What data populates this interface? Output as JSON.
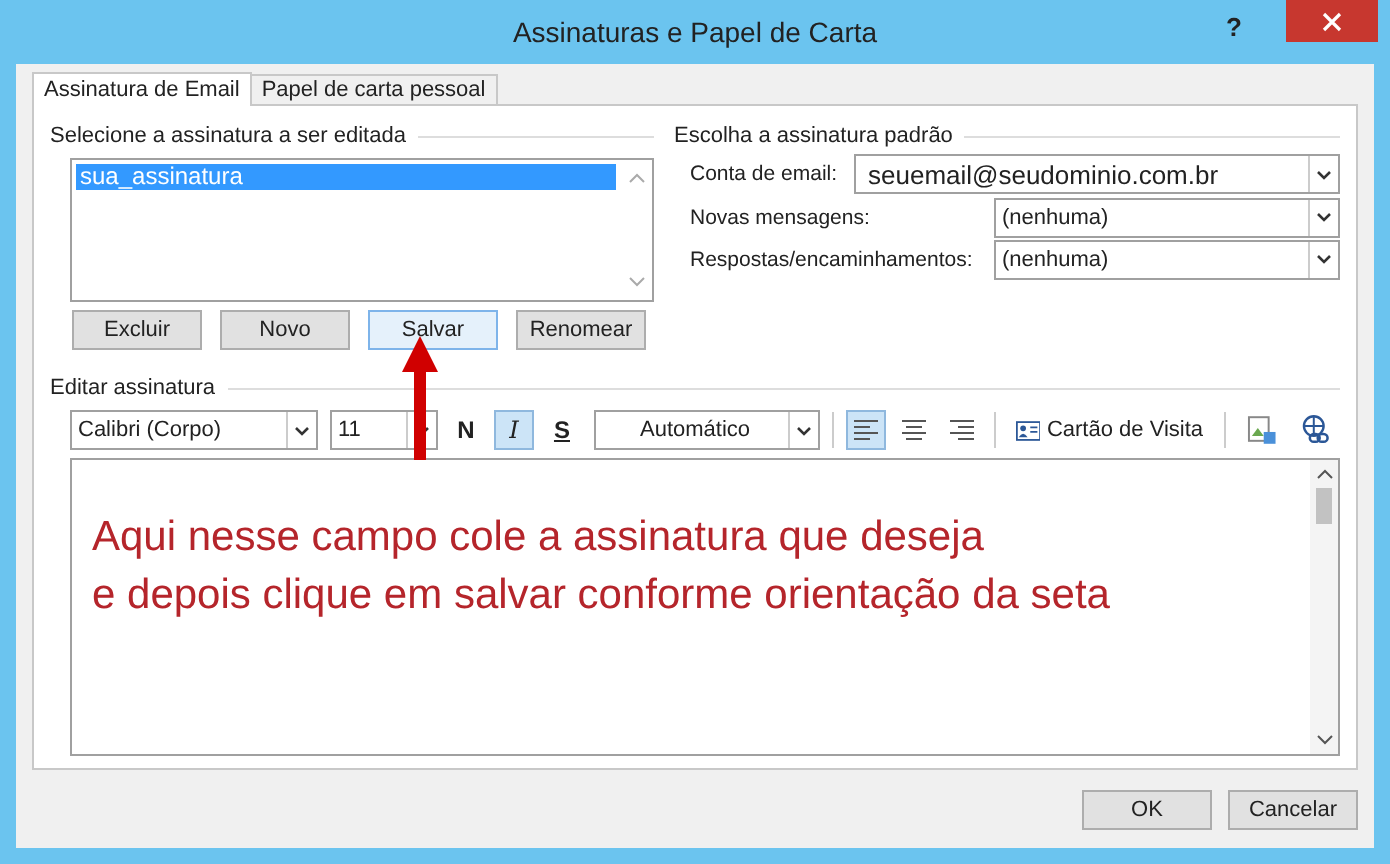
{
  "window": {
    "title": "Assinaturas e Papel de Carta",
    "help": "?"
  },
  "tabs": [
    {
      "label": "Assinatura de Email",
      "selected": true
    },
    {
      "label": "Papel de carta pessoal",
      "selected": false
    }
  ],
  "select_signature": {
    "heading": "Selecione a assinatura a ser editada",
    "items": [
      {
        "label": "sua_assinatura",
        "selected": true
      }
    ],
    "buttons": [
      {
        "label": "Excluir",
        "highlighted": false
      },
      {
        "label": "Novo",
        "highlighted": false
      },
      {
        "label": "Salvar",
        "highlighted": true
      },
      {
        "label": "Renomear",
        "highlighted": false
      }
    ]
  },
  "default_signature": {
    "heading": "Escolha a assinatura padrão",
    "fields": [
      {
        "label": "Conta de email:",
        "value": "seuemail@seudominio.com.br",
        "large": true
      },
      {
        "label": "Novas mensagens:",
        "value": "(nenhuma)",
        "large": false
      },
      {
        "label": "Respostas/encaminhamentos:",
        "value": "(nenhuma)",
        "large": false
      }
    ]
  },
  "editor": {
    "heading": "Editar assinatura",
    "font": "Calibri (Corpo)",
    "size": "11",
    "styles": [
      {
        "label": "N",
        "kind": "bold",
        "selected": false
      },
      {
        "label": "I",
        "kind": "italic",
        "selected": true
      },
      {
        "label": "S",
        "kind": "underline",
        "selected": false
      }
    ],
    "color_name": "Automático",
    "align": [
      {
        "kind": "left",
        "selected": true
      },
      {
        "kind": "center",
        "selected": false
      },
      {
        "kind": "right",
        "selected": false
      }
    ],
    "business_card": "Cartão de Visita",
    "annotation": [
      "Aqui nesse campo cole a assinatura que deseja",
      "e depois clique em salvar conforme orientação da seta"
    ]
  },
  "footer_buttons": [
    "OK",
    "Cancelar"
  ]
}
